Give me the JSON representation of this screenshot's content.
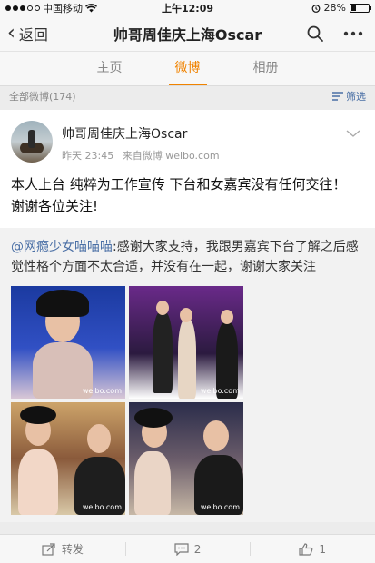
{
  "status_bar": {
    "carrier": "中国移动",
    "time": "上午12:09",
    "battery": "28%",
    "battery_level": 0.28
  },
  "nav": {
    "back_label": "返回",
    "title": "帅哥周佳庆上海Oscar"
  },
  "tabs": [
    {
      "label": "主页",
      "active": false
    },
    {
      "label": "微博",
      "active": true
    },
    {
      "label": "相册",
      "active": false
    }
  ],
  "filter_bar": {
    "count_label": "全部微博(174)",
    "filter_label": "筛选"
  },
  "post": {
    "username": "帅哥周佳庆上海Oscar",
    "time": "昨天 23:45",
    "source": "来自微博 weibo.com",
    "text": "本人上台 纯粹为工作宣传 下台和女嘉宾没有任何交往！ 谢谢各位关注!",
    "repost": {
      "mention": "@网瘾少女喵喵喵",
      "text": ":感谢大家支持，我跟男嘉宾下台了解之后感觉性格个方面不太合适，并没有在一起，谢谢大家关注"
    },
    "photos": [
      {
        "watermark": "weibo.com"
      },
      {
        "watermark": "weibo.com"
      },
      {
        "watermark": "weibo.com"
      },
      {
        "watermark": "weibo.com"
      }
    ]
  },
  "actions": {
    "repost_label": "转发",
    "comment_count": "2",
    "like_count": "1"
  },
  "colors": {
    "accent": "#f08300",
    "link": "#4a6fa5"
  }
}
